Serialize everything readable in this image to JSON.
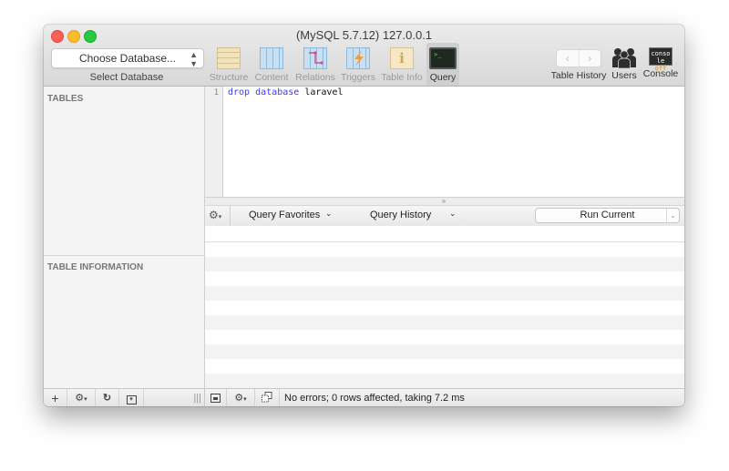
{
  "window": {
    "title": "(MySQL 5.7.12) 127.0.0.1"
  },
  "toolbar": {
    "database_popup": "Choose Database...",
    "database_label": "Select Database",
    "tools": [
      {
        "label": "Structure",
        "icon": "structure-icon",
        "enabled": false
      },
      {
        "label": "Content",
        "icon": "content-icon",
        "enabled": false
      },
      {
        "label": "Relations",
        "icon": "relations-icon",
        "enabled": false
      },
      {
        "label": "Triggers",
        "icon": "triggers-icon",
        "enabled": false
      },
      {
        "label": "Table Info",
        "icon": "table-info-icon",
        "enabled": false
      },
      {
        "label": "Query",
        "icon": "query-icon",
        "enabled": true,
        "selected": true
      }
    ],
    "right_tools": [
      {
        "label": "Table History",
        "icon": "back-forward-icon",
        "back_glyph": "‹",
        "forward_glyph": "›"
      },
      {
        "label": "Users",
        "icon": "users-icon",
        "glyph": "👤👤"
      },
      {
        "label": "Console",
        "icon": "console-icon",
        "line1": "conso",
        "line2_a": "le ",
        "line2_b": "off"
      }
    ]
  },
  "sidebar": {
    "tables_heading": "TABLES",
    "table_info_heading": "TABLE INFORMATION"
  },
  "editor": {
    "line_numbers": [
      "1"
    ],
    "query_keyword1": "drop",
    "query_keyword2": "database",
    "query_identifier": "laravel"
  },
  "query_bar": {
    "gear_glyph": "⚙",
    "favorites_label": "Query Favorites",
    "history_label": "Query History",
    "chevron_glyph": "⌄",
    "run_label": "Run Current",
    "run_arrow_glyph": "⌄"
  },
  "status_bar": {
    "add_glyph": "+",
    "gear_glyph": "⚙",
    "refresh_glyph": "↻",
    "filter_glyph": "▾",
    "divider_glyph": "|||",
    "message": "No errors; 0 rows affected, taking 7.2 ms"
  },
  "colors": {
    "keyword": "#3a3aff",
    "close": "#fc5f57",
    "minimize": "#fdbc2e",
    "maximize": "#28c840"
  }
}
